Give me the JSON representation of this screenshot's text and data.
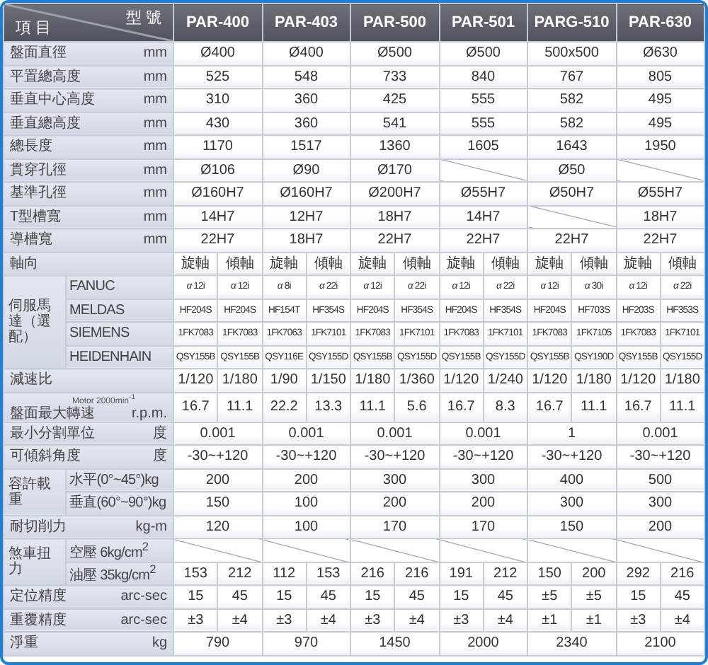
{
  "header": {
    "item_label": "項 目",
    "model_label": "型 號",
    "models": [
      "PAR-400",
      "PAR-403",
      "PAR-500",
      "PAR-501",
      "PARG-510",
      "PAR-630"
    ]
  },
  "rows": [
    {
      "kind": "single",
      "label": "盤面直徑",
      "unit": "mm",
      "values": [
        "Ø400",
        "Ø400",
        "Ø500",
        "Ø500",
        "500x500",
        "Ø630"
      ]
    },
    {
      "kind": "single",
      "label": "平置總高度",
      "unit": "mm",
      "values": [
        "525",
        "548",
        "733",
        "840",
        "767",
        "805"
      ]
    },
    {
      "kind": "single",
      "label": "垂直中心高度",
      "unit": "mm",
      "values": [
        "310",
        "360",
        "425",
        "555",
        "582",
        "495"
      ]
    },
    {
      "kind": "single",
      "label": "垂直總高度",
      "unit": "mm",
      "values": [
        "430",
        "360",
        "541",
        "555",
        "582",
        "495"
      ]
    },
    {
      "kind": "single",
      "label": "總長度",
      "unit": "mm",
      "values": [
        "1170",
        "1517",
        "1360",
        "1605",
        "1643",
        "1950"
      ]
    },
    {
      "kind": "single",
      "label": "貫穿孔徑",
      "unit": "mm",
      "values": [
        "Ø106",
        "Ø90",
        "Ø170",
        {
          "kind": "slash"
        },
        "Ø50",
        {
          "kind": "slash"
        }
      ]
    },
    {
      "kind": "single",
      "label": "基準孔徑",
      "unit": "mm",
      "values": [
        "Ø160H7",
        "Ø160H7",
        "Ø200H7",
        "Ø55H7",
        "Ø50H7",
        "Ø55H7"
      ]
    },
    {
      "kind": "single",
      "label": "T型槽寬",
      "unit": "mm",
      "values": [
        "14H7",
        "12H7",
        "18H7",
        "14H7",
        {
          "kind": "slash"
        },
        "18H7"
      ]
    },
    {
      "kind": "single",
      "label": "導槽寬",
      "unit": "mm",
      "values": [
        "22H7",
        "18H7",
        "22H7",
        "22H7",
        "22H7",
        "22H7"
      ]
    },
    {
      "kind": "pair",
      "label": "軸向",
      "values": [
        "旋軸",
        "傾軸",
        "旋軸",
        "傾軸",
        "旋軸",
        "傾軸",
        "旋軸",
        "傾軸",
        "旋軸",
        "傾軸",
        "旋軸",
        "傾軸"
      ]
    },
    {
      "kind": "group",
      "label": "伺服馬達（選配）",
      "subrows": [
        {
          "kind": "pair",
          "label": "FANUC",
          "values": [
            "*α* 12i",
            "*α* 12i",
            "*α* 8i",
            "*α* 22i",
            "*α* 12i",
            "*α* 22i",
            "*α* 12i",
            "*α* 22i",
            "*α* 12i",
            "*α* 30i",
            "*α* 12i",
            "*α* 22i"
          ]
        },
        {
          "kind": "pair",
          "label": "MELDAS",
          "values": [
            "HF204S",
            "HF204S",
            "HF154T",
            "HF354S",
            "HF204S",
            "HF354S",
            "HF204S",
            "HF354S",
            "HF204S",
            "HF703S",
            "HF203S",
            "HF353S"
          ]
        },
        {
          "kind": "pair",
          "label": "SIEMENS",
          "values": [
            "1FK7083",
            "1FK7083",
            "1FK7063",
            "1FK7101",
            "1FK7083",
            "1FK7101",
            "1FK7083",
            "1FK7101",
            "1FK7083",
            "1FK7105",
            "1FK7083",
            "1FK7101"
          ]
        },
        {
          "kind": "pair",
          "label": "HEIDENHAIN",
          "values": [
            "QSY155B",
            "QSY155B",
            "QSY116E",
            "QSY155D",
            "QSY155B",
            "QSY155D",
            "QSY155B",
            "QSY155D",
            "QSY155B",
            "QSY190D",
            "QSY155B",
            "QSY155D"
          ]
        }
      ]
    },
    {
      "kind": "pair",
      "label": "減速比",
      "values": [
        "1/120",
        "1/180",
        "1/90",
        "1/150",
        "1/180",
        "1/360",
        "1/120",
        "1/240",
        "1/120",
        "1/180",
        "1/120",
        "1/180"
      ]
    },
    {
      "kind": "pair",
      "label": "盤面最大轉速",
      "note": "Motor 2000min$^{-1}$",
      "unit": "r.p.m.",
      "values": [
        "16.7",
        "11.1",
        "22.2",
        "13.3",
        "11.1",
        "5.6",
        "16.7",
        "8.3",
        "16.7",
        "11.1",
        "16.7",
        "11.1"
      ]
    },
    {
      "kind": "single",
      "label": "最小分割單位",
      "unit": "度",
      "values": [
        "0.001",
        "0.001",
        "0.001",
        "0.001",
        "1",
        "0.001"
      ]
    },
    {
      "kind": "single",
      "label": "可傾斜角度",
      "unit": "度",
      "values": [
        "-30~+120",
        "-30~+120",
        "-30~+120",
        "-30~+120",
        "-30~+120",
        "-30~+120"
      ]
    },
    {
      "kind": "group",
      "label": "容許載重",
      "subrows": [
        {
          "kind": "single",
          "label": "水平(0°~45°)kg",
          "values": [
            "200",
            "200",
            "300",
            "300",
            "400",
            "500"
          ]
        },
        {
          "kind": "single",
          "label": "垂直(60°~90°)kg",
          "values": [
            "150",
            "100",
            "200",
            "200",
            "300",
            "300"
          ]
        }
      ]
    },
    {
      "kind": "single",
      "label": "耐切削力",
      "unit": "kg-m",
      "values": [
        "120",
        "100",
        "170",
        "170",
        "150",
        "200"
      ]
    },
    {
      "kind": "group",
      "label": "煞車扭力",
      "subrows": [
        {
          "kind": "slash_row",
          "label": "空壓  6kg/cm$^{2}$"
        },
        {
          "kind": "pair",
          "label": "油壓  35kg/cm$^{2}$",
          "values": [
            "153",
            "212",
            "112",
            "153",
            "216",
            "216",
            "191",
            "212",
            "150",
            "200",
            "292",
            "216"
          ]
        }
      ]
    },
    {
      "kind": "pair",
      "label": "定位精度",
      "unit": "arc-sec",
      "values": [
        "15",
        "45",
        "15",
        "45",
        "15",
        "45",
        "15",
        "45",
        "±5",
        "±5",
        "15",
        "45"
      ]
    },
    {
      "kind": "pair",
      "label": "重覆精度",
      "unit": "arc-sec",
      "values": [
        "±3",
        "±4",
        "±3",
        "±4",
        "±3",
        "±4",
        "±3",
        "±4",
        "±1",
        "±1",
        "±3",
        "±4"
      ]
    },
    {
      "kind": "single",
      "label": "淨重",
      "unit": "kg",
      "values": [
        "790",
        "970",
        "1450",
        "2000",
        "2340",
        "2100"
      ]
    }
  ]
}
